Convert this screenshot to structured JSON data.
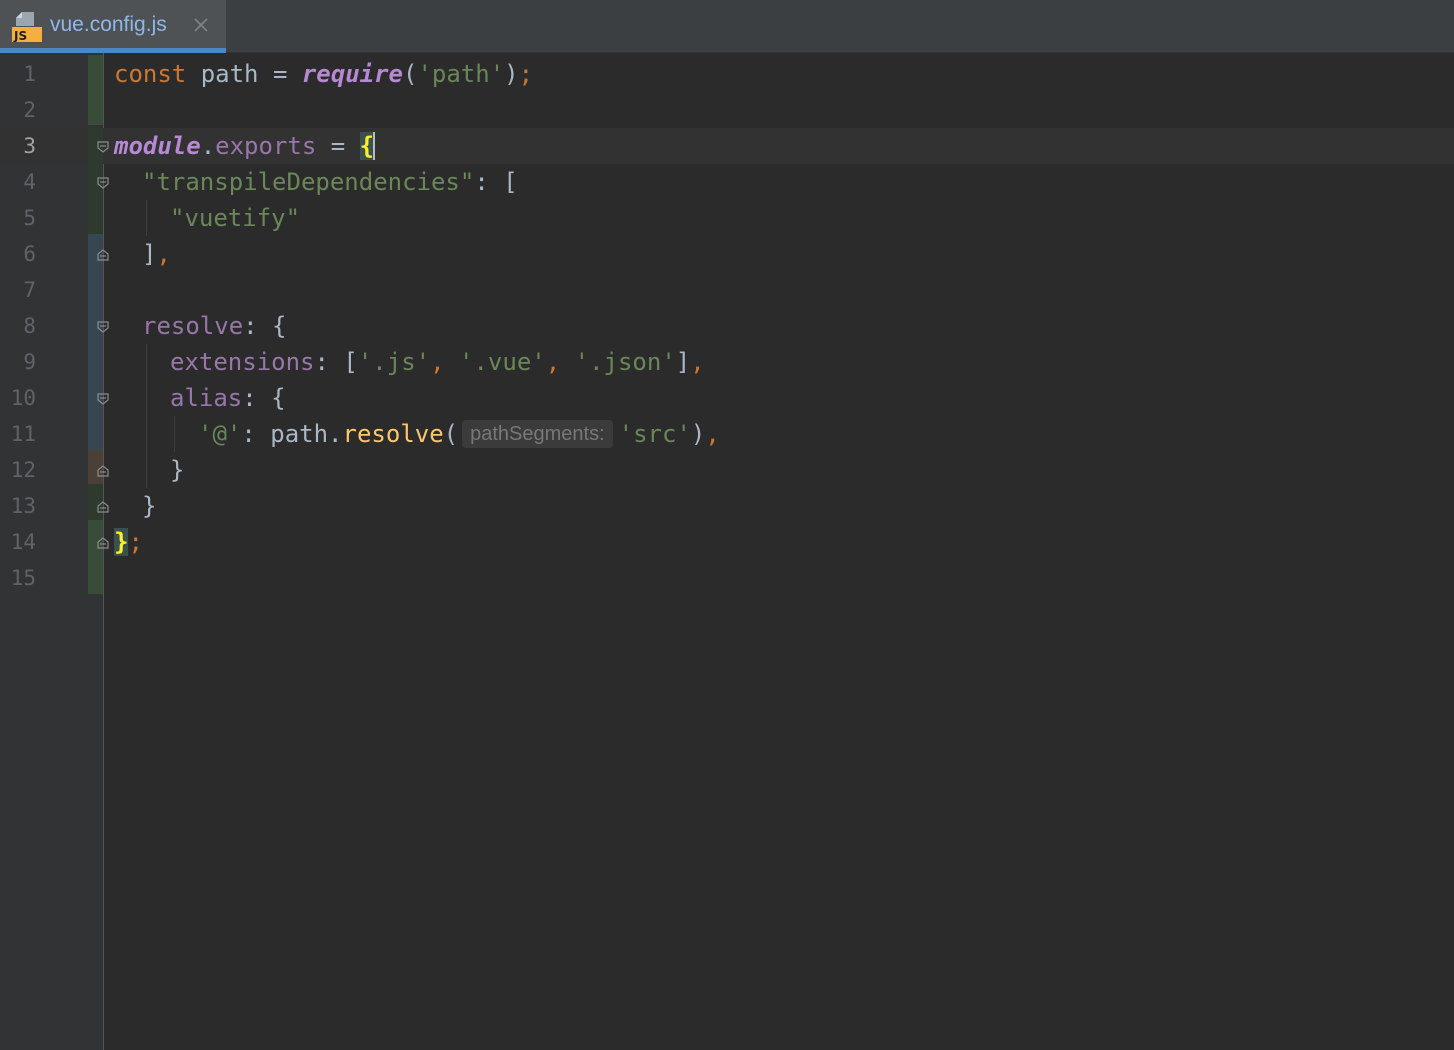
{
  "tab": {
    "title": "vue.config.js",
    "icon": "js-file-icon",
    "icon_label": "JS"
  },
  "editor": {
    "current_line": 3,
    "line_numbers": [
      "1",
      "2",
      "3",
      "4",
      "5",
      "6",
      "7",
      "8",
      "9",
      "10",
      "11",
      "12",
      "13",
      "14",
      "15"
    ],
    "code": {
      "l1": {
        "t1": "const",
        "t2": " path = ",
        "t3": "require",
        "t4": "(",
        "t5": "'path'",
        "t6": ")",
        "t7": ";"
      },
      "l3": {
        "t1": "module",
        "t2": ".",
        "t3": "exports",
        "t4": " = ",
        "t5": "{"
      },
      "l4": {
        "t1": "\"transpileDependencies\"",
        "t2": ": ["
      },
      "l5": {
        "t1": "\"vuetify\""
      },
      "l6": {
        "t1": "]",
        "t2": ","
      },
      "l8": {
        "t1": "resolve",
        "t2": ": {"
      },
      "l9": {
        "t1": "extensions",
        "t2": ": [",
        "t3": "'.js'",
        "t4": ", ",
        "t5": "'.vue'",
        "t6": ", ",
        "t7": "'.json'",
        "t8": "]",
        "t9": ","
      },
      "l10": {
        "t1": "alias",
        "t2": ": {"
      },
      "l11": {
        "t1": "'@'",
        "t2": ": path.",
        "t3": "resolve",
        "t4": "(",
        "hint": "pathSegments:",
        "t5": "'src'",
        "t6": ")",
        "t7": ","
      },
      "l12": {
        "t1": "}"
      },
      "l13": {
        "t1": "}"
      },
      "l14": {
        "t1": "}",
        "t2": ";"
      }
    }
  },
  "colors": {
    "keyword": "#cc7832",
    "string": "#6a8759",
    "property": "#9876aa",
    "function": "#ffc66d",
    "tab_underline": "#4a88c7",
    "change_added": "#384c38",
    "change_modified": "#374752"
  }
}
